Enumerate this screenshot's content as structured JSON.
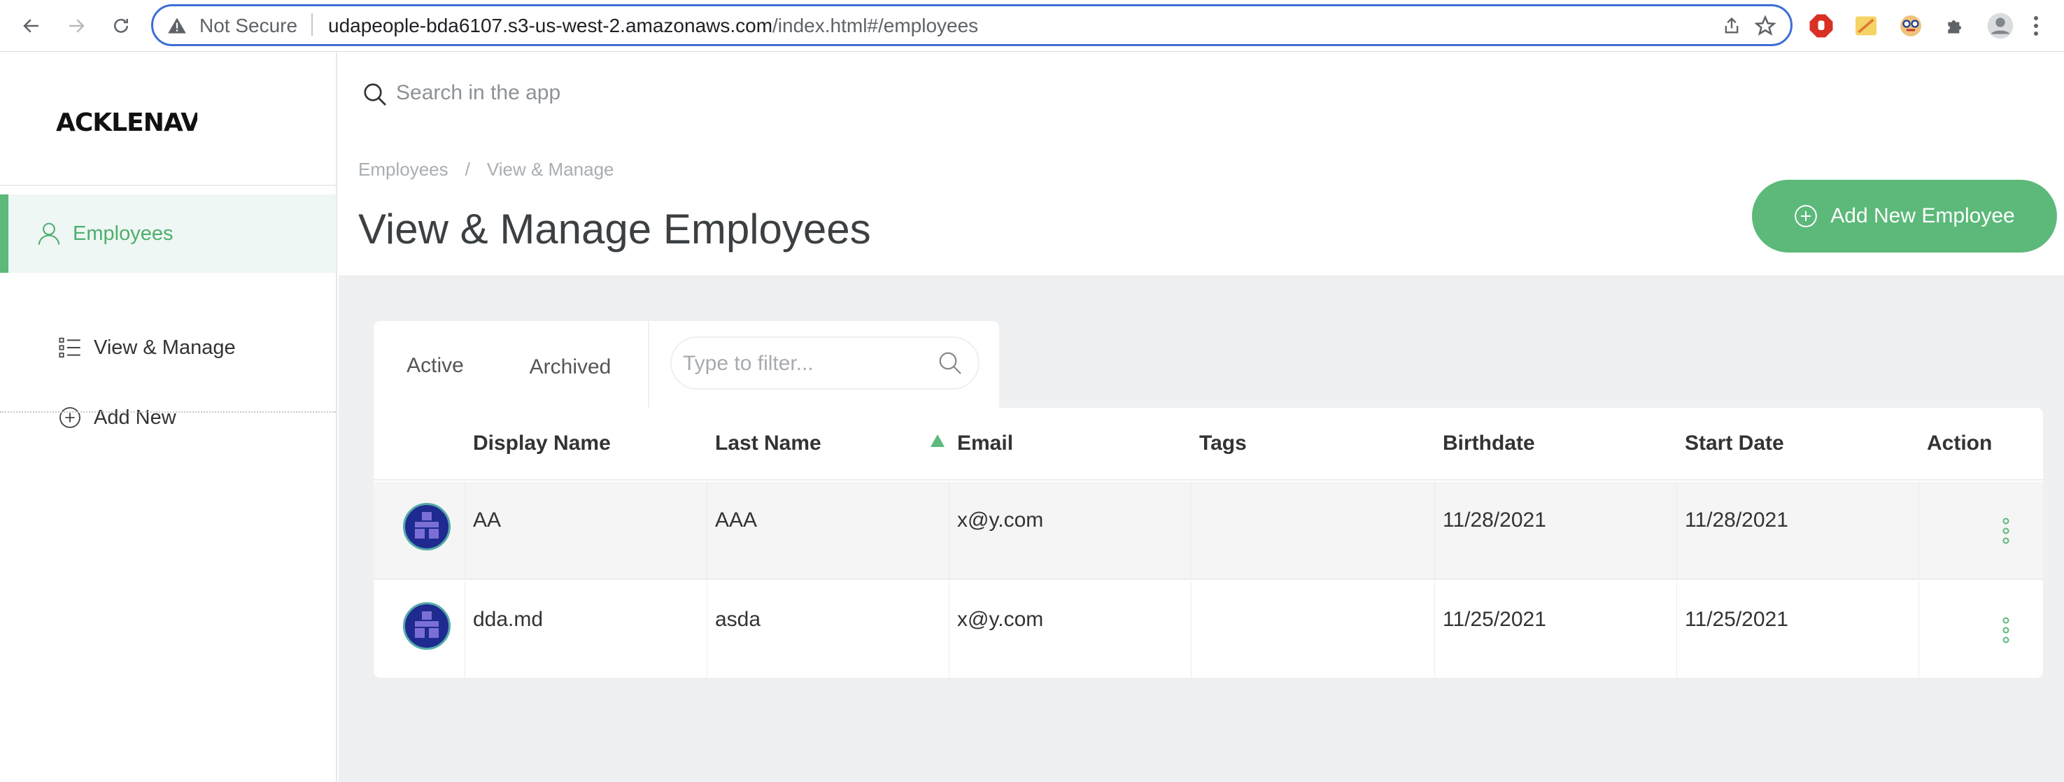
{
  "browser": {
    "security_label": "Not Secure",
    "url_host": "udapeople-bda6107.s3-us-west-2.amazonaws.com",
    "url_path": "/index.html#/employees"
  },
  "app": {
    "logo_text": "ACKLENAVENUE",
    "search_placeholder": "Search in the app"
  },
  "sidebar": {
    "section": "Employees",
    "items": [
      {
        "label": "View & Manage",
        "icon": "list-icon"
      },
      {
        "label": "Add New",
        "icon": "plus-circle-icon"
      }
    ]
  },
  "header": {
    "breadcrumb": [
      "Employees",
      "/",
      "View & Manage"
    ],
    "title": "View & Manage Employees",
    "add_button": "Add New Employee"
  },
  "tabs": {
    "active": "Active",
    "archived": "Archived",
    "filter_placeholder": "Type to filter..."
  },
  "table": {
    "columns": [
      "Display Name",
      "Last Name",
      "Email",
      "Tags",
      "Birthdate",
      "Start Date",
      "Action"
    ],
    "rows": [
      {
        "display_name": "AA",
        "last_name": "AAA",
        "email": "x@y.com",
        "tags": "",
        "birthdate": "11/28/2021",
        "start_date": "11/28/2021"
      },
      {
        "display_name": "dda.md",
        "last_name": "asda",
        "email": "x@y.com",
        "tags": "",
        "birthdate": "11/25/2021",
        "start_date": "11/25/2021"
      }
    ]
  },
  "colors": {
    "accent": "#5cb97a",
    "accent_light": "#eef7f3",
    "chrome_focus": "#3c6ed7"
  }
}
